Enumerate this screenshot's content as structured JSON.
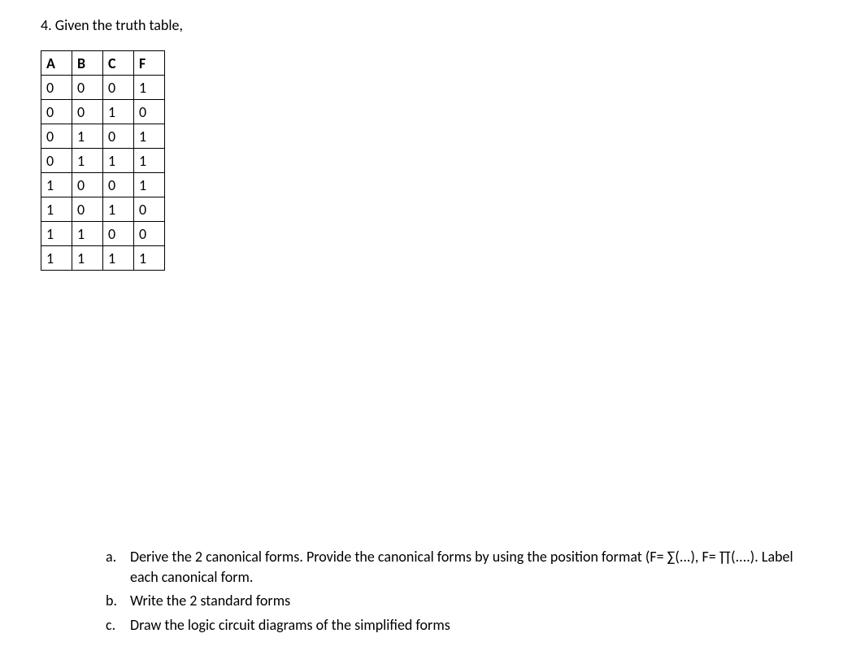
{
  "question": {
    "number": "4.",
    "prompt": "Given the truth table,"
  },
  "table": {
    "headers": [
      "A",
      "B",
      "C",
      "F"
    ],
    "rows": [
      [
        "0",
        "0",
        "0",
        "1"
      ],
      [
        "0",
        "0",
        "1",
        "0"
      ],
      [
        "0",
        "1",
        "0",
        "1"
      ],
      [
        "0",
        "1",
        "1",
        "1"
      ],
      [
        "1",
        "0",
        "0",
        "1"
      ],
      [
        "1",
        "0",
        "1",
        "0"
      ],
      [
        "1",
        "1",
        "0",
        "0"
      ],
      [
        "1",
        "1",
        "1",
        "1"
      ]
    ]
  },
  "subquestions": [
    {
      "label": "a.",
      "text": "Derive the 2 canonical forms. Provide the canonical forms by using the position format (F= ∑(...), F= ∏(....). Label each canonical form."
    },
    {
      "label": "b.",
      "text": "Write the 2 standard forms"
    },
    {
      "label": "c.",
      "text": "Draw the logic circuit diagrams of the simplified forms"
    }
  ]
}
